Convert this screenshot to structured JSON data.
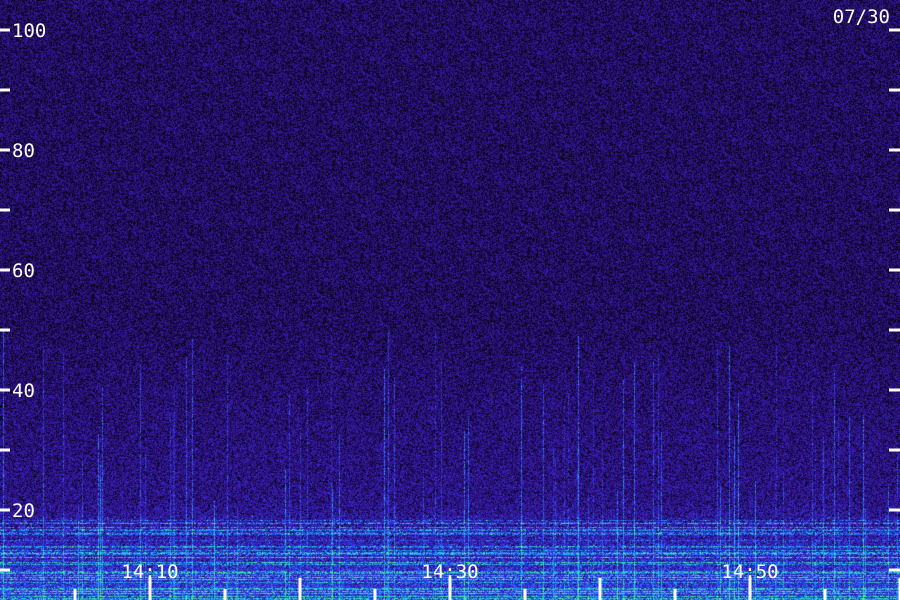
{
  "chart_data": {
    "type": "heatmap",
    "title": "",
    "date": "07/30",
    "xlabel": "",
    "ylabel": "",
    "y_ticks": [
      {
        "value": 100,
        "label": "100"
      },
      {
        "value": 80,
        "label": "80"
      },
      {
        "value": 60,
        "label": "60"
      },
      {
        "value": 40,
        "label": "40"
      },
      {
        "value": 20,
        "label": "20"
      }
    ],
    "y_minor_ticks": [
      90,
      70,
      50,
      30,
      10
    ],
    "ylim": [
      5,
      105
    ],
    "x_ticks": [
      {
        "value": "14:10",
        "label": "14:10"
      },
      {
        "value": "14:30",
        "label": "14:30"
      },
      {
        "value": "14:50",
        "label": "14:50"
      }
    ],
    "x_range_minutes": [
      "14:02",
      "15:02"
    ],
    "colormap": [
      "#000000",
      "#2a0f6b",
      "#3a1fc8",
      "#2d6cff",
      "#19d0e0",
      "#4dff6a"
    ],
    "background_color": "#2a0f6b",
    "label_color": "#ffffff"
  }
}
